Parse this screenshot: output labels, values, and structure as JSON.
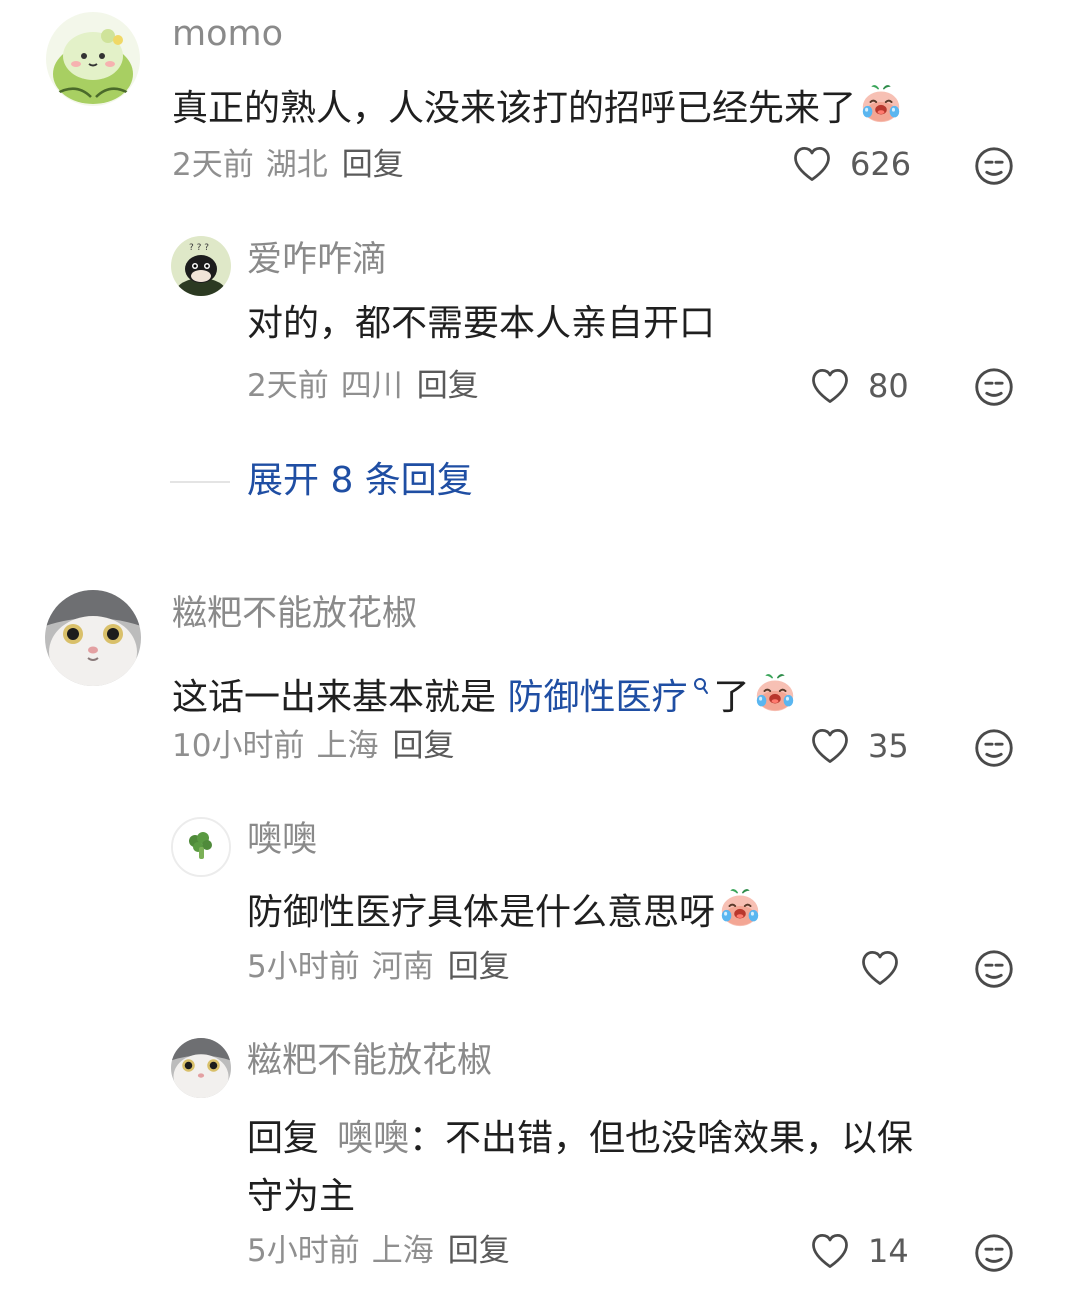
{
  "comments": [
    {
      "username": "momo",
      "content": "真正的熟人，人没来该打的招呼已经先来了",
      "time": "2天前",
      "location": "湖北",
      "reply_label": "回复",
      "likes": "626",
      "replies": [
        {
          "username": "爱咋咋滴",
          "content": "对的，都不需要本人亲自开口",
          "time": "2天前",
          "location": "四川",
          "reply_label": "回复",
          "likes": "80"
        }
      ],
      "expand_text": "展开 8 条回复"
    },
    {
      "username": "糍粑不能放花椒",
      "content_prefix": "这话一出来基本就是",
      "content_link": "防御性医疗",
      "content_suffix": "了",
      "time": "10小时前",
      "location": "上海",
      "reply_label": "回复",
      "likes": "35",
      "replies": [
        {
          "username": "噢噢",
          "content": "防御性医疗具体是什么意思呀",
          "time": "5小时前",
          "location": "河南",
          "reply_label": "回复",
          "likes": ""
        },
        {
          "username": "糍粑不能放花椒",
          "content_reply_tag": "回复",
          "content_reply_to": "噢噢",
          "content_line1": "：不出错，但也没啥效果，以保",
          "content_line2": "守为主",
          "time": "5小时前",
          "location": "上海",
          "reply_label": "回复",
          "likes": "14"
        }
      ]
    }
  ],
  "icons": {
    "like": "heart-outline-icon",
    "dislike": "meh-face-icon",
    "emoji": "crying-laugh-emoji",
    "search": "magnifier-icon"
  },
  "colors": {
    "link": "#1f4ea3",
    "meta": "#8f8f8f",
    "name": "#8a8a8a"
  }
}
